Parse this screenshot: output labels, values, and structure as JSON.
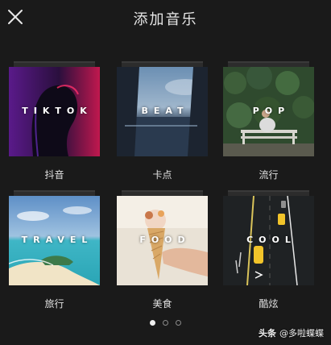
{
  "header": {
    "title": "添加音乐",
    "close_icon": "close-icon"
  },
  "categories": [
    {
      "label": "抖音",
      "cover_word": "TIKTOK"
    },
    {
      "label": "卡点",
      "cover_word": "BEAT"
    },
    {
      "label": "流行",
      "cover_word": "POP"
    },
    {
      "label": "旅行",
      "cover_word": "TRAVEL"
    },
    {
      "label": "美食",
      "cover_word": "FOOD"
    },
    {
      "label": "酷炫",
      "cover_word": "COOL"
    }
  ],
  "pagination": {
    "total_pages": 3,
    "current_page": 1
  },
  "watermark": {
    "brand": "头条",
    "handle": "@多啦蝶蝶"
  },
  "colors": {
    "background": "#1a1a1a",
    "text": "#e6e6e6"
  }
}
